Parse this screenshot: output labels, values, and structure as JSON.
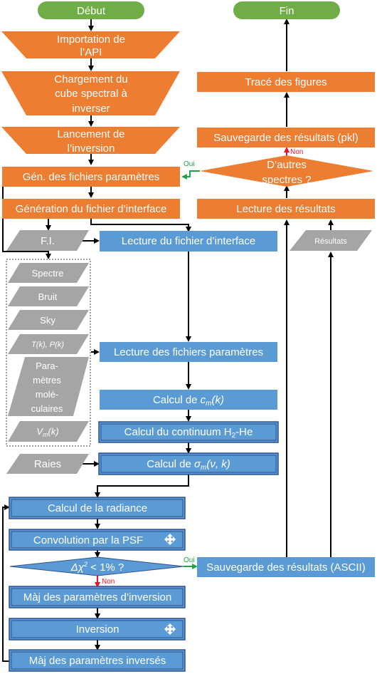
{
  "colors": {
    "terminal": "#70ad47",
    "process_orange": "#ed7d31",
    "process_blue": "#5b9bd5",
    "process_blue_border": "#2f528f",
    "data_gray": "#a5a5a5",
    "edge": "#000000",
    "yes_edge": "#1fa34a",
    "no_edge": "#e8132a"
  },
  "nodes": {
    "start": "Début",
    "end": "Fin",
    "import_api": [
      "Importation de",
      "l’API"
    ],
    "load_cube": [
      "Chargement du",
      "cube spectral à",
      "inverser"
    ],
    "launch_inversion": [
      "Lancement de",
      "l’inversion"
    ],
    "gen_param_files": "Gén. des fichiers paramètres",
    "gen_interface_file": "Génération du fichier d’interface",
    "fi_data": "F.I.",
    "read_interface_file": "Lecture du fichier d’interface",
    "spectre": "Spectre",
    "bruit": "Bruit",
    "sky": "Sky",
    "tk_pk": "T(k), P(k)",
    "mol_params": [
      "Para-",
      "mètres",
      "molé-",
      "culaires"
    ],
    "vm_k": {
      "main": "V",
      "sub": "m",
      "rest": "(k)"
    },
    "read_param_files": "Lecture des fichiers paramètres",
    "calc_cm": {
      "prefix": "Calcul de ",
      "var": "c",
      "sub": "m",
      "rest": "(k)"
    },
    "calc_continuum": {
      "prefix": "Calcul  du continuum H",
      "sub": "2",
      "rest": "-He"
    },
    "raies": "Raies",
    "calc_sigma": {
      "prefix": "Calcul de ",
      "var": "σ",
      "sub": "m",
      "rest": "(ν, k)"
    },
    "calc_radiance": "Calcul de la radiance",
    "convolution_psf": "Convolution par la PSF",
    "chi2_decision": {
      "prefix": "Δχ",
      "sup": "2",
      "rest": " < 1% ?"
    },
    "update_inv_params": "Màj des paramètres d’inversion",
    "inversion": "Inversion",
    "update_inverted_params": "Màj des paramètres inversés",
    "save_ascii": "Sauvegarde des résultats (ASCII)",
    "resultats": "Résultats",
    "read_results": "Lecture des résultats",
    "more_spectra": [
      "D’autres",
      "spectres ?"
    ],
    "save_pkl": "Sauvegarde des résultats (pkl)",
    "plot_figures": "Tracé des figures"
  },
  "edge_labels": {
    "yes": "Oui",
    "no": "Non"
  },
  "icons": {
    "parallel": "move-arrows-icon"
  }
}
